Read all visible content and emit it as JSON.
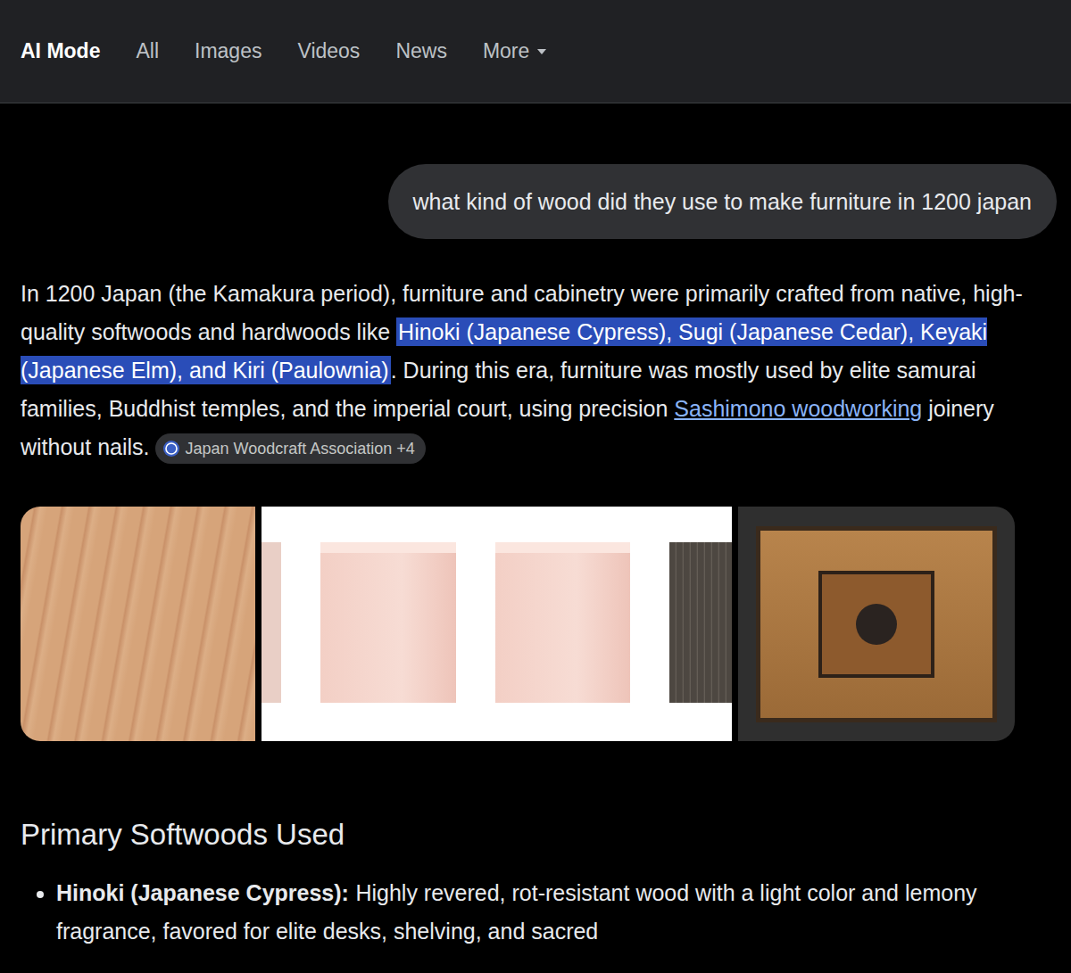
{
  "nav": {
    "tabs": [
      {
        "label": "AI Mode",
        "selected": true
      },
      {
        "label": "All",
        "selected": false
      },
      {
        "label": "Images",
        "selected": false
      },
      {
        "label": "Videos",
        "selected": false
      },
      {
        "label": "News",
        "selected": false
      },
      {
        "label": "More",
        "selected": false
      }
    ]
  },
  "query": "what kind of wood did they use to make furniture in 1200 japan",
  "answer": {
    "segments": [
      {
        "text": "In 1200 Japan (the Kamakura period), furniture and cabinetry were primarily crafted from native, high-quality softwoods and hardwoods like ",
        "kind": "plain"
      },
      {
        "text": "Hinoki (Japanese Cypress), Sugi (Japanese Cedar), Keyaki (Japanese Elm), and Kiri (Paulownia)",
        "kind": "highlight"
      },
      {
        "text": ". During this era, furniture was mostly used by elite samurai families, Buddhist temples, and the imperial court, using precision ",
        "kind": "plain"
      },
      {
        "text": "Sashimono woodworking",
        "kind": "link"
      },
      {
        "text": " joinery without nails.",
        "kind": "plain"
      }
    ],
    "source_chip": {
      "label": "Japan Woodcraft Association +4"
    }
  },
  "section": {
    "heading": "Primary Softwoods Used",
    "items": [
      {
        "term": "Hinoki (Japanese Cypress):",
        "text": "Highly revered, rot-resistant wood with a light color and lemony fragrance, favored for elite desks, shelving, and sacred"
      }
    ]
  }
}
